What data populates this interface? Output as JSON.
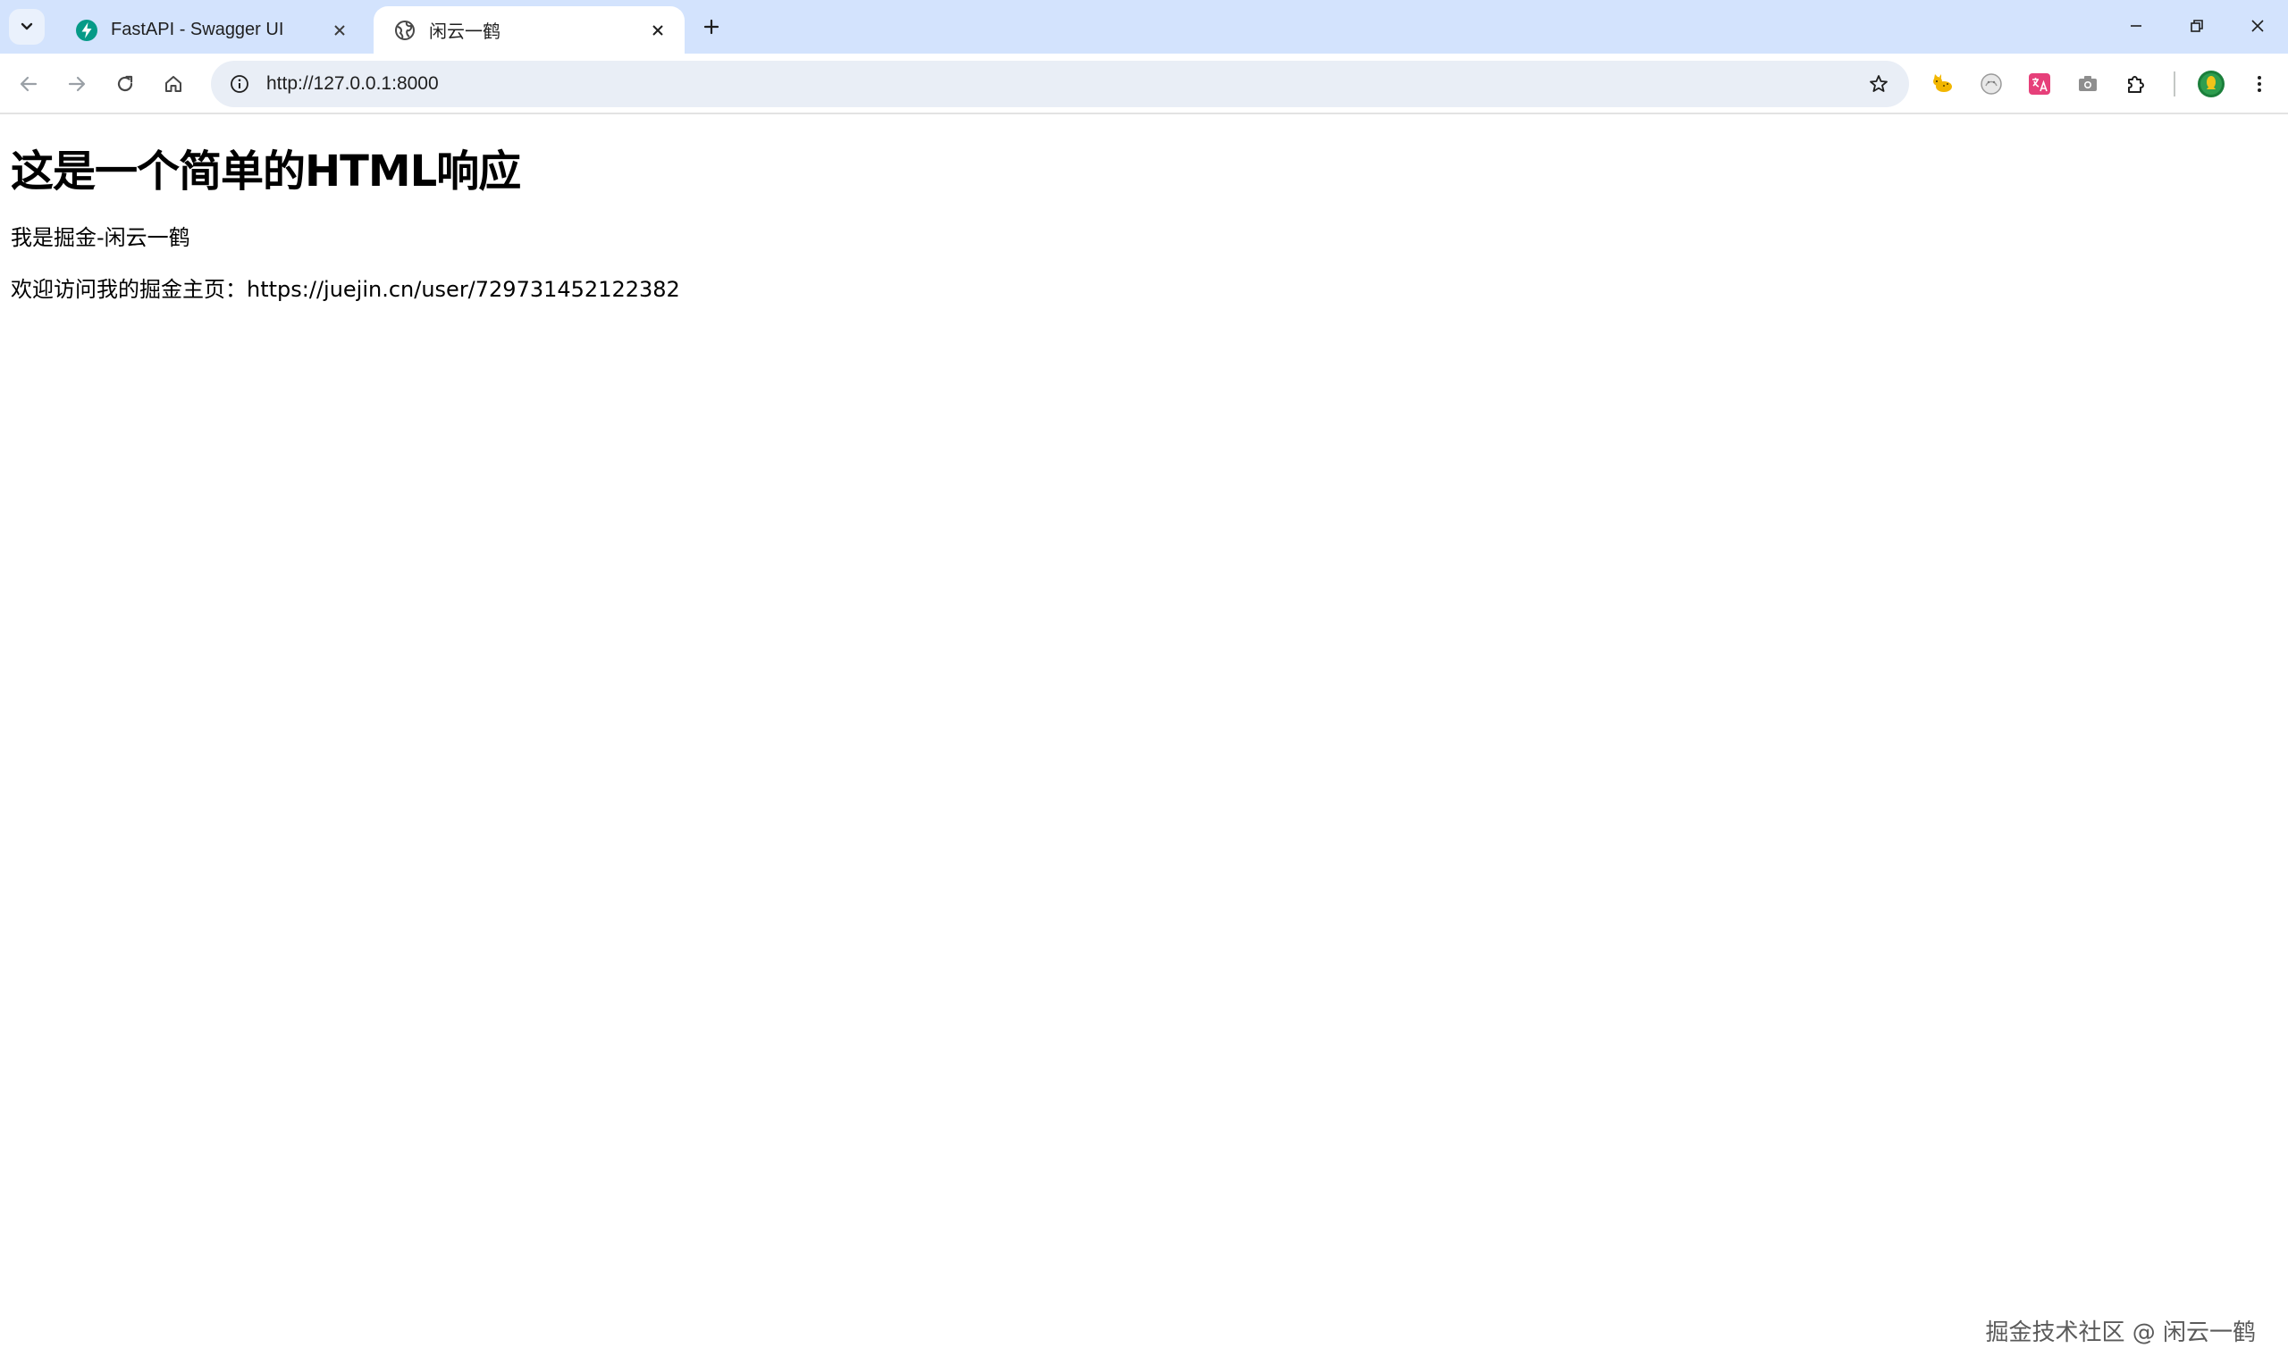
{
  "browser": {
    "tabs": [
      {
        "title": "FastAPI - Swagger UI",
        "icon": "fastapi-icon",
        "active": false
      },
      {
        "title": "闲云一鹤",
        "icon": "globe-icon",
        "active": true
      }
    ],
    "address_bar": {
      "url": "http://127.0.0.1:8000"
    },
    "extensions": [
      "cat-extension-icon",
      "ghost-extension-icon",
      "translate-extension-icon",
      "camera-extension-icon",
      "puzzle-extensions-icon",
      "profile-avatar-icon",
      "more-menu-icon"
    ],
    "colors": {
      "tabstrip": "#d3e3fd",
      "omnibox": "#e9eef6",
      "fastapi_green": "#059a87"
    }
  },
  "page": {
    "heading": "这是一个简单的HTML响应",
    "paragraphs": [
      "我是掘金-闲云一鹤",
      "欢迎访问我的掘金主页：https://juejin.cn/user/729731452122382"
    ]
  },
  "watermark": "掘金技术社区 @ 闲云一鹤"
}
